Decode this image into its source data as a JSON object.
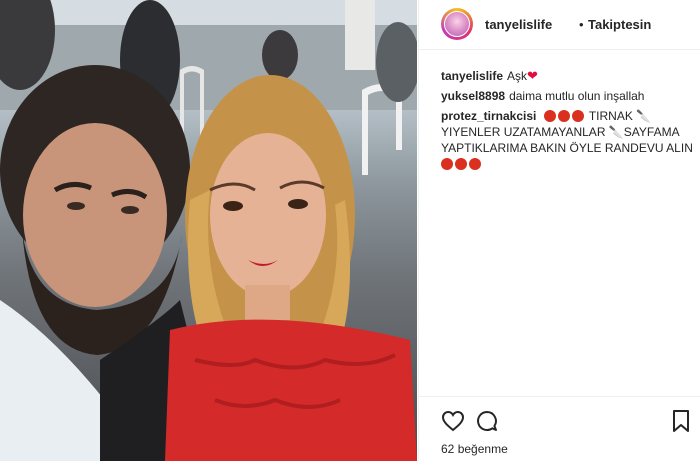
{
  "header": {
    "username": "tanyelislife",
    "separator": "•",
    "follow_status": "Takiptesin"
  },
  "caption": {
    "username": "tanyelislife",
    "text": "Aşk",
    "emoji": "heart-icon"
  },
  "comments": [
    {
      "username": "yuksel8898",
      "text": "daima mutlu olun inşallah"
    },
    {
      "username": "protez_tirnakcisi",
      "part1": "TIRNAK",
      "part2": "YIYENLER UZATAMAYANLAR",
      "part3": "SAYFAMA YAPTIKLARIMA BAKIN ÖYLE RANDEVU ALIN"
    }
  ],
  "actions": {
    "like_count": "62",
    "like_label": "beğenme"
  },
  "colors": {
    "accent_heart": "#e0103c",
    "border": "#efefef",
    "text": "#262626"
  }
}
